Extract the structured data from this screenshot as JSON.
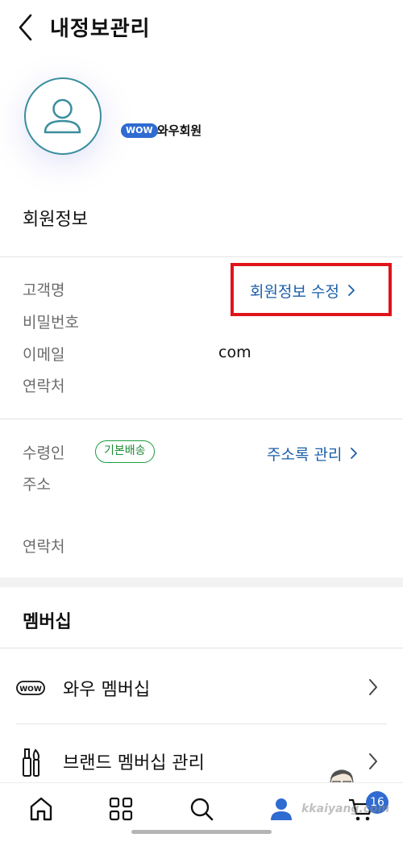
{
  "header": {
    "title": "내정보관리",
    "back_icon": "chevron-left-icon"
  },
  "profile": {
    "avatar_icon": "user-avatar-icon",
    "wow_badge": "WOW",
    "membership_label": "와우회원"
  },
  "member_info": {
    "title": "회원정보",
    "labels": [
      "고객명",
      "비밀번호",
      "이메일",
      "연락처"
    ],
    "email_value": "com",
    "edit_link": "회원정보 수정"
  },
  "address_info": {
    "recipient_label": "수령인",
    "default_tag": "기본배송",
    "address_label": "주소",
    "phone_label": "연락처",
    "manage_link": "주소록 관리"
  },
  "membership": {
    "title": "멤버십",
    "items": [
      {
        "label": "와우 멤버십",
        "icon": "wow-badge-icon"
      },
      {
        "label": "브랜드 멤버십 관리",
        "icon": "cosmetics-brush-icon"
      }
    ]
  },
  "bottom_nav": {
    "items": [
      "home-icon",
      "categories-grid-icon",
      "search-icon",
      "my-profile-icon",
      "cart-icon"
    ],
    "cart_count": "16"
  },
  "watermark": {
    "text": "kkaiyang.com"
  },
  "colors": {
    "link": "#1c5fa8",
    "highlight": "#e0141b",
    "tag_green": "#1c9c3c",
    "badge_blue": "#2f6bd1"
  }
}
